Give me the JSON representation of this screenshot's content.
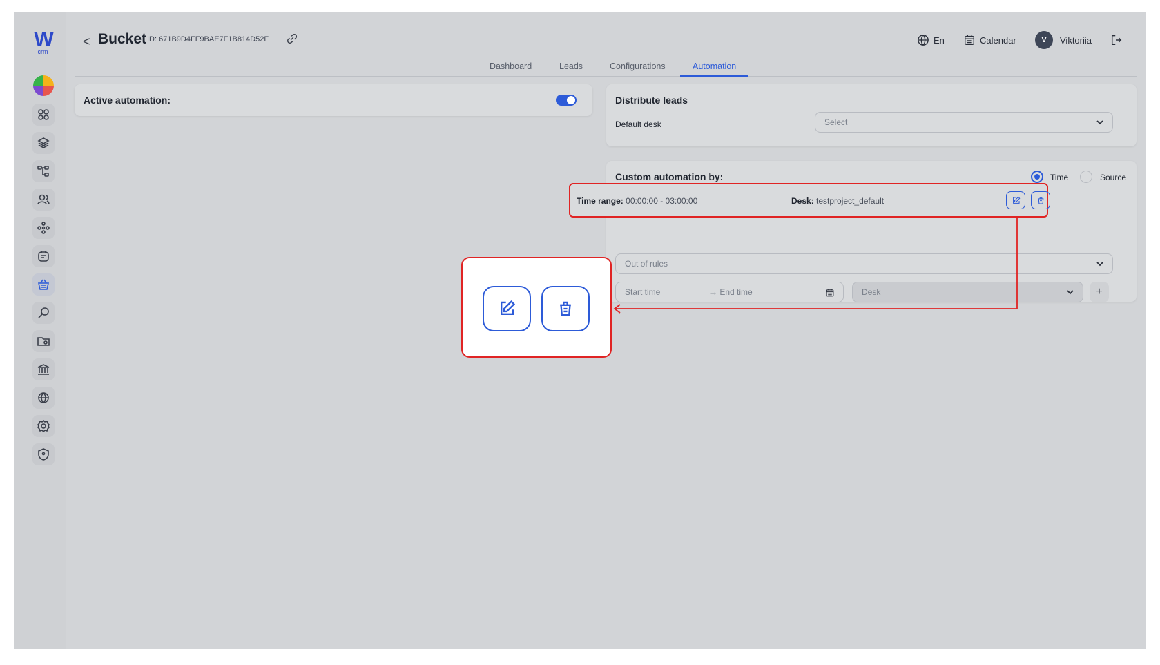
{
  "app": {
    "logo_text": "W",
    "logo_sub": "crm"
  },
  "header": {
    "back_label": "<",
    "title": "Bucket",
    "id_text": "ID: 671B9D4FF9BAE7F1B814D52F",
    "language": "En",
    "calendar_label": "Calendar",
    "avatar_initial": "V",
    "user_name": "Viktoriia"
  },
  "tabs": [
    "Dashboard",
    "Leads",
    "Configurations",
    "Automation"
  ],
  "active_tab": "Automation",
  "active_automation": {
    "label": "Active automation:",
    "enabled": true
  },
  "distribute": {
    "title": "Distribute leads",
    "default_desk_label": "Default desk",
    "default_desk_placeholder": "Select"
  },
  "custom": {
    "title": "Custom automation by:",
    "options": [
      "Time",
      "Source"
    ],
    "selected": "Time",
    "rule": {
      "time_range_label": "Time range:",
      "time_range_value": "00:00:00 - 03:00:00",
      "desk_label": "Desk:",
      "desk_value": "testproject_default"
    },
    "out_of_rules_placeholder": "Out of rules",
    "start_time_placeholder": "Start time",
    "end_time_placeholder": "→ End time",
    "desk_placeholder": "Desk",
    "add_label": "+"
  },
  "sidebar_icons": [
    "dashboard-icon",
    "layers-icon",
    "hierarchy-icon",
    "users-icon",
    "network-icon",
    "notes-icon",
    "basket-icon",
    "key-search-icon",
    "folder-icon",
    "bank-icon",
    "globe-grid-icon",
    "settings-icon",
    "shield-icon"
  ],
  "colors": {
    "accent": "#2d5bd8",
    "highlight": "#e02424",
    "overlay": "#d2d4d7"
  }
}
